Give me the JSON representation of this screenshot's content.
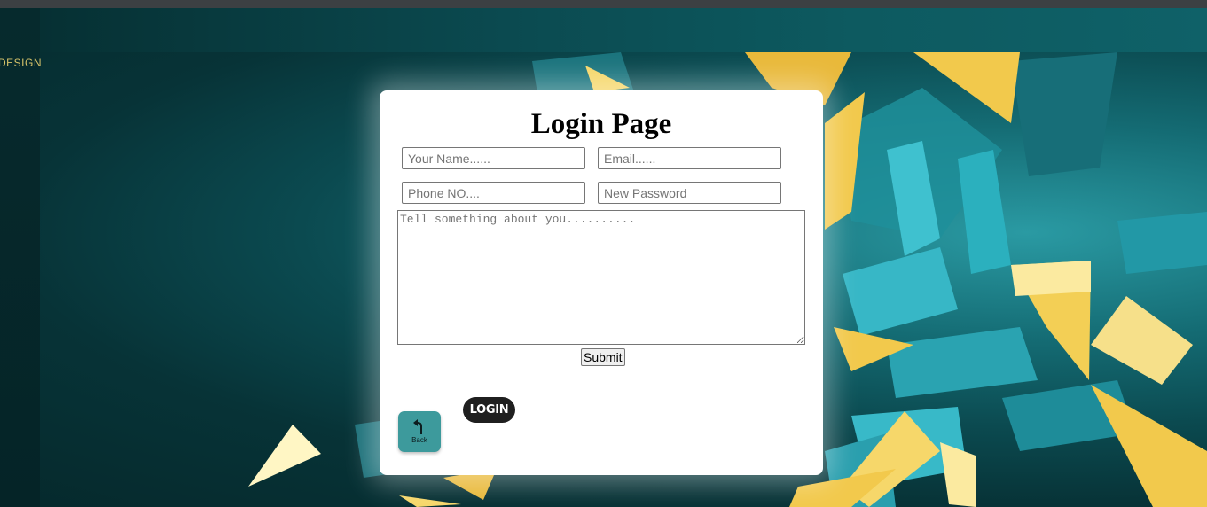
{
  "brand": {
    "text": "DESIGN",
    "color": "#d8c46a"
  },
  "form": {
    "title": "Login Page",
    "name_placeholder": "Your Name......",
    "email_placeholder": "Email......",
    "phone_placeholder": "Phone NO....",
    "password_placeholder": "New Password",
    "about_placeholder": "Tell something about you..........",
    "submit_label": "Submit"
  },
  "buttons": {
    "back_label": "Back",
    "back_icon": "back-arrow-icon",
    "login_label": "LOGIN"
  },
  "colors": {
    "background_teal": "#0b4a50",
    "crystal_gold": "#f2c94c",
    "back_button": "#3d9a9c",
    "login_button": "#1f1f1f"
  }
}
